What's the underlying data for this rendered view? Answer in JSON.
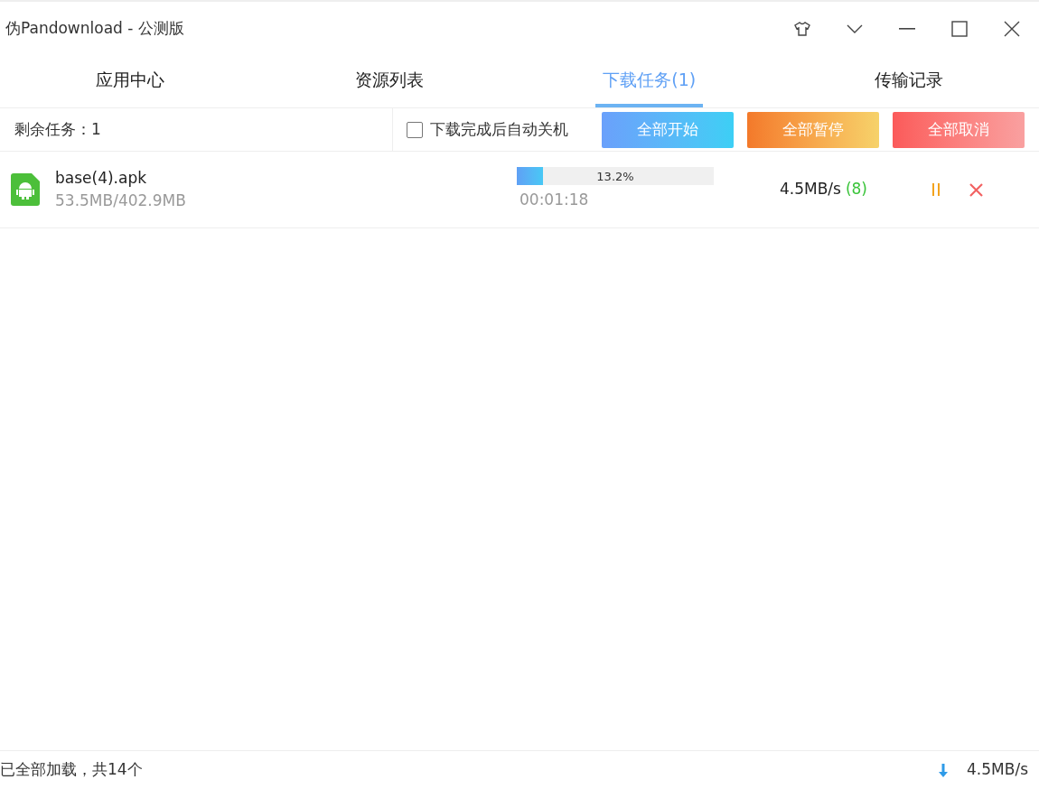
{
  "window": {
    "title": "伪Pandownload - 公测版"
  },
  "tabs": [
    {
      "label": "应用中心",
      "selected": false
    },
    {
      "label": "资源列表",
      "selected": false
    },
    {
      "label": "下载任务(1)",
      "selected": true
    },
    {
      "label": "传输记录",
      "selected": false
    }
  ],
  "toolbar": {
    "remaining": "剩余任务：1",
    "auto_shutdown": {
      "label": "下载完成后自动关机",
      "checked": false
    },
    "buttons": [
      {
        "kind": "start",
        "label": "全部开始"
      },
      {
        "kind": "pause",
        "label": "全部暂停"
      },
      {
        "kind": "cancel",
        "label": "全部取消"
      }
    ]
  },
  "tasks": [
    {
      "name": "base(4).apk",
      "size": "53.5MB/402.9MB",
      "level": 0.132,
      "percent": "13.2%",
      "time": "00:01:18",
      "speed": "4.5MB/s",
      "connections": "(8)"
    }
  ],
  "status_bar": {
    "text": "已全部加载，共14个",
    "speed": "4.5MB/s"
  }
}
